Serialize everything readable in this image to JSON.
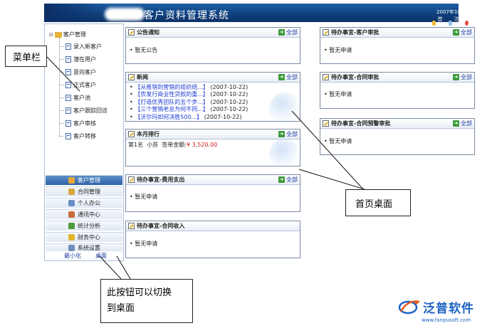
{
  "header": {
    "title": "客户资料管理系统",
    "date_line": "2007年10月22日  星期一",
    "links": [
      {
        "label": "首页",
        "icon": "home-icon"
      },
      {
        "label": "注销",
        "icon": "logout-icon"
      },
      {
        "label": "退出",
        "icon": "exit-icon"
      }
    ]
  },
  "sidebar": {
    "root_label": "客户管理",
    "root_toggle": "⊟",
    "tree_items": [
      "录入新客户",
      "潜在用户",
      "意向客户",
      "正式客户",
      "客户池",
      "客户跟踪回访",
      "客户审核",
      "客户转移"
    ],
    "menu_bars": [
      {
        "label": "客户管理",
        "icon": "customer-management-icon",
        "color": "#e8a53a"
      },
      {
        "label": "合同管理",
        "icon": "contract-icon",
        "color": "#d9a640"
      },
      {
        "label": "个人办公",
        "icon": "office-icon",
        "color": "#6b8ec6"
      },
      {
        "label": "通讯中心",
        "icon": "communication-icon",
        "color": "#c86a3a"
      },
      {
        "label": "统计分析",
        "icon": "statistics-icon",
        "color": "#4f9a3a"
      },
      {
        "label": "财务中心",
        "icon": "finance-icon",
        "color": "#e0b52a"
      },
      {
        "label": "系统设置",
        "icon": "settings-icon",
        "color": "#6f8fb8"
      }
    ],
    "bottom_links": [
      "最小化",
      "桌面"
    ]
  },
  "panels": {
    "all_label": "全部",
    "notice": {
      "title": "公告通知",
      "body": "• 暂无公告"
    },
    "news": {
      "title": "新闻",
      "items": [
        {
          "title": "【从推销到营销的组织结...】",
          "date": "(2007-10-22)"
        },
        {
          "title": "【农发行商业性贷款的重...】",
          "date": "(2007-10-22)"
        },
        {
          "title": "【打造优秀团队的五个步...】",
          "date": "(2007-10-22)"
        },
        {
          "title": "【三个营销老总为何不同...】",
          "date": "(2007-10-22)"
        },
        {
          "title": "【沃尔玛如何决胜500...】",
          "date": "(2007-10-22)"
        }
      ]
    },
    "ranking": {
      "title": "本月排行",
      "rank": "第1名",
      "name": "小苏",
      "amount_label": "签单金额:",
      "amount": "¥ 3,520.00"
    },
    "expense": {
      "title": "待办事宜-费用支出",
      "body": "• 暂无申请"
    },
    "contract_income": {
      "title": "待办事宜-合同收入",
      "body": "• 暂无申请"
    },
    "customer_approval": {
      "title": "待办事宜-客户审批",
      "body": "• 暂无申请"
    },
    "contract_approval": {
      "title": "待办事宜-合同审批",
      "body": "• 暂无申请"
    },
    "contract_warning": {
      "title": "待办事宜-合同预警审批",
      "body": "• 暂无申请"
    }
  },
  "callouts": {
    "menu": "菜单栏",
    "desktop": "首页桌面",
    "switch_line1": "此按钮可以切换",
    "switch_line2": "到桌面"
  },
  "brand": {
    "name": "泛普软件",
    "url": "www.fanpusoft.com"
  }
}
